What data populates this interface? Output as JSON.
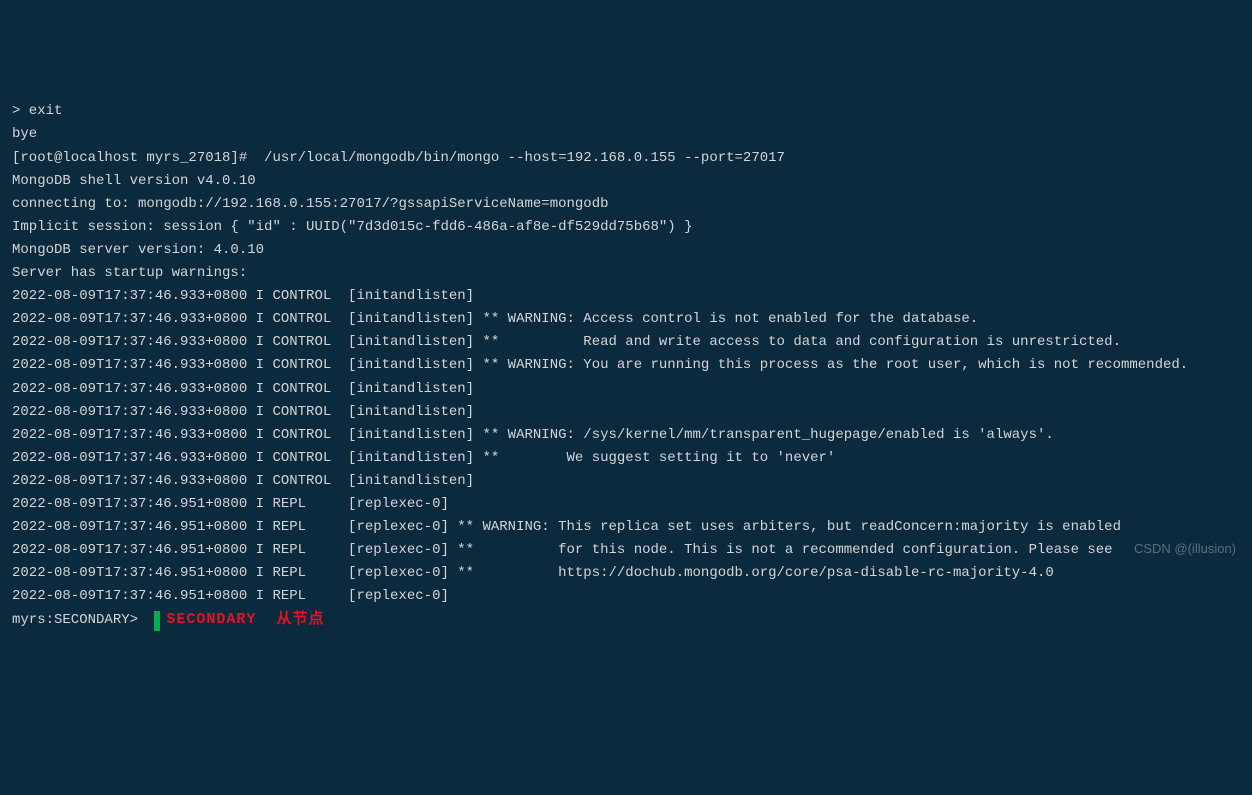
{
  "lines": [
    "> exit",
    "bye",
    "[root@localhost myrs_27018]#  /usr/local/mongodb/bin/mongo --host=192.168.0.155 --port=27017",
    "MongoDB shell version v4.0.10",
    "connecting to: mongodb://192.168.0.155:27017/?gssapiServiceName=mongodb",
    "Implicit session: session { \"id\" : UUID(\"7d3d015c-fdd6-486a-af8e-df529dd75b68\") }",
    "MongoDB server version: 4.0.10",
    "Server has startup warnings: ",
    "2022-08-09T17:37:46.933+0800 I CONTROL  [initandlisten] ",
    "2022-08-09T17:37:46.933+0800 I CONTROL  [initandlisten] ** WARNING: Access control is not enabled for the database.",
    "2022-08-09T17:37:46.933+0800 I CONTROL  [initandlisten] **          Read and write access to data and configuration is unrestricted.",
    "2022-08-09T17:37:46.933+0800 I CONTROL  [initandlisten] ** WARNING: You are running this process as the root user, which is not recommended.",
    "2022-08-09T17:37:46.933+0800 I CONTROL  [initandlisten] ",
    "2022-08-09T17:37:46.933+0800 I CONTROL  [initandlisten] ",
    "2022-08-09T17:37:46.933+0800 I CONTROL  [initandlisten] ** WARNING: /sys/kernel/mm/transparent_hugepage/enabled is 'always'.",
    "2022-08-09T17:37:46.933+0800 I CONTROL  [initandlisten] **        We suggest setting it to 'never'",
    "2022-08-09T17:37:46.933+0800 I CONTROL  [initandlisten] ",
    "2022-08-09T17:37:46.951+0800 I REPL     [replexec-0] ",
    "2022-08-09T17:37:46.951+0800 I REPL     [replexec-0] ** WARNING: This replica set uses arbiters, but readConcern:majority is enabled ",
    "2022-08-09T17:37:46.951+0800 I REPL     [replexec-0] **          for this node. This is not a recommended configuration. Please see ",
    "2022-08-09T17:37:46.951+0800 I REPL     [replexec-0] **          https://dochub.mongodb.org/core/psa-disable-rc-majority-4.0",
    "2022-08-09T17:37:46.951+0800 I REPL     [replexec-0] "
  ],
  "prompt": "myrs:SECONDARY> ",
  "annotation": "SECONDARY  从节点",
  "watermark": "CSDN @(illusion)"
}
